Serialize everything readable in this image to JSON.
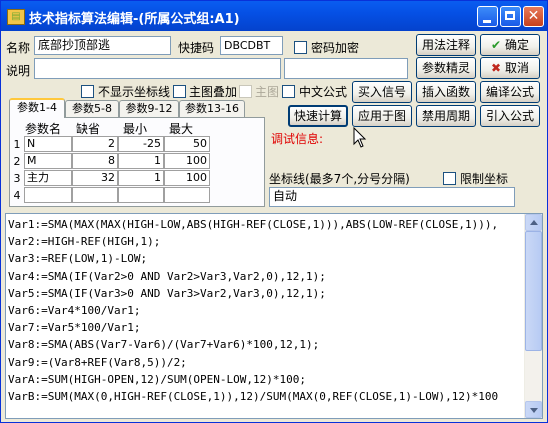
{
  "window": {
    "title": "技术指标算法编辑-(所属公式组:A1)"
  },
  "form": {
    "name_label": "名称",
    "name_value": "底部抄顶部逃",
    "password_label": "快捷码",
    "password_value": "DBCDBT",
    "encrypt_label": "密码加密",
    "desc_label": "说明",
    "desc_value": "",
    "hide_axis_label": "不显示坐标线",
    "main_overlay_label": "主图叠加",
    "main_chart_label": "主图",
    "chinese_formula_label": "中文公式"
  },
  "buttons": {
    "usage_notes": "用法注释",
    "ok": "确定",
    "param_wizard": "参数精灵",
    "cancel": "取消",
    "import_signal": "买入信号",
    "insert_function": "插入函数",
    "compile": "编译公式",
    "quick_calc": "快速计算",
    "apply_chart": "应用于图",
    "disable_period": "禁用周期",
    "import_formula": "引入公式"
  },
  "tabs": [
    "参数1-4",
    "参数5-8",
    "参数9-12",
    "参数13-16"
  ],
  "params": {
    "headers": [
      "参数名",
      "缺省",
      "最小",
      "最大"
    ],
    "rows": [
      {
        "num": "1",
        "name": "N",
        "default": "2",
        "min": "-25",
        "max": "50"
      },
      {
        "num": "2",
        "name": "M",
        "default": "8",
        "min": "1",
        "max": "100"
      },
      {
        "num": "3",
        "name": "主力",
        "default": "32",
        "min": "1",
        "max": "100"
      },
      {
        "num": "4",
        "name": "",
        "default": "",
        "min": "",
        "max": ""
      }
    ]
  },
  "debug": {
    "label": "调试信息:"
  },
  "axis": {
    "label": "坐标线(最多7个,分号分隔)",
    "limit_label": "限制坐标",
    "value": "自动"
  },
  "code_lines": [
    "Var1:=SMA(MAX(MAX(HIGH-LOW,ABS(HIGH-REF(CLOSE,1))),ABS(LOW-REF(CLOSE,1))),",
    "Var2:=HIGH-REF(HIGH,1);",
    "Var3:=REF(LOW,1)-LOW;",
    "Var4:=SMA(IF(Var2>0 AND Var2>Var3,Var2,0),12,1);",
    "Var5:=SMA(IF(Var3>0 AND Var3>Var2,Var3,0),12,1);",
    "Var6:=Var4*100/Var1;",
    "Var7:=Var5*100/Var1;",
    "Var8:=SMA(ABS(Var7-Var6)/(Var7+Var6)*100,12,1);",
    "Var9:=(Var8+REF(Var8,5))/2;",
    "VarA:=SUM(HIGH-OPEN,12)/SUM(OPEN-LOW,12)*100;",
    "VarB:=SUM(MAX(0,HIGH-REF(CLOSE,1)),12)/SUM(MAX(0,REF(CLOSE,1)-LOW),12)*100"
  ]
}
